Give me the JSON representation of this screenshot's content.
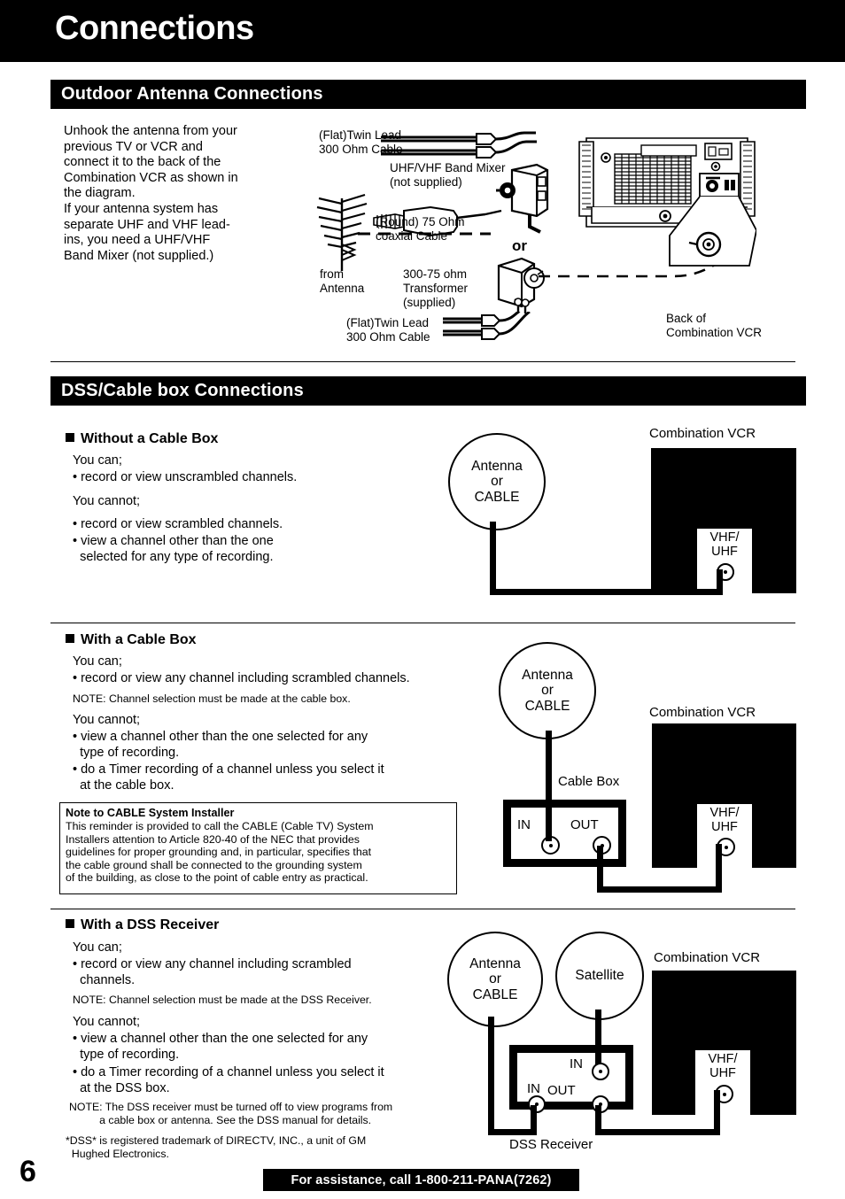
{
  "document": {
    "title": "Connections",
    "page_number": "6"
  },
  "sections": {
    "outdoor": {
      "header": "Outdoor Antenna Connections",
      "body": "Unhook the antenna from your\nprevious TV or VCR and\nconnect it to the back of the\nCombination VCR as shown in\nthe diagram.\nIf your antenna system has\nseparate UHF and VHF lead-\nins, you need a UHF/VHF\nBand Mixer (not supplied.)",
      "diagram": {
        "twin_lead_top": "(Flat)Twin Lead\n300 Ohm Cable",
        "band_mixer": "UHF/VHF Band Mixer\n(not supplied)",
        "coaxial": "(Round) 75 Ohm\ncoaxial Cable",
        "or": "or",
        "from_antenna": "from\nAntenna",
        "transformer": "300-75 ohm\nTransformer\n(supplied)",
        "twin_lead_bottom": "(Flat)Twin Lead\n300 Ohm Cable",
        "back_of_vcr": "Back of\nCombination VCR"
      }
    },
    "dss": {
      "header": "DSS/Cable box Connections",
      "without_cable_box": {
        "heading": "Without a Cable Box",
        "can_label": "You can;",
        "can_items": [
          "• record or view unscrambled channels."
        ],
        "cannot_label": "You cannot;",
        "cannot_items": [
          "• record or view scrambled channels.",
          "• view a channel other than the one\n  selected for any type of recording."
        ],
        "diagram": {
          "source_circle": "Antenna\nor\nCABLE",
          "vcr_label": "Combination VCR",
          "vcr_jack": "VHF/\nUHF"
        }
      },
      "with_cable_box": {
        "heading": "With a Cable Box",
        "can_label": "You can;",
        "can_items": [
          "• record or view any channel including scrambled channels."
        ],
        "note": "NOTE: Channel selection must be made at the cable box.",
        "cannot_label": "You cannot;",
        "cannot_items": [
          "• view a channel other than the one selected for any\n  type of recording.",
          "• do a Timer recording of a channel unless you select it\n  at the cable box."
        ],
        "installer_note": {
          "title": "Note to CABLE System Installer",
          "body": "This reminder is provided to call the CABLE (Cable TV) System\nInstallers attention to Article 820-40 of the NEC that provides\nguidelines for proper grounding and, in particular, specifies that\nthe cable ground shall be connected to the grounding system\nof the building, as close to the point of cable entry as practical."
        },
        "diagram": {
          "source_circle": "Antenna\nor\nCABLE",
          "cable_box_label": "Cable Box",
          "cable_box_in": "IN",
          "cable_box_out": "OUT",
          "vcr_label": "Combination VCR",
          "vcr_jack": "VHF/\nUHF"
        }
      },
      "with_dss_receiver": {
        "heading": "With a DSS Receiver",
        "can_label": "You can;",
        "can_items": [
          "• record or view any channel including scrambled\n  channels."
        ],
        "note": "NOTE: Channel selection must be made at the DSS Receiver.",
        "cannot_label": "You cannot;",
        "cannot_items": [
          "• view a channel other than the one selected for any\n  type of recording.",
          "• do a Timer recording of a channel unless you select it\n  at the DSS box."
        ],
        "note2": "NOTE: The DSS receiver must be turned off to view programs from\n          a cable box or antenna. See the DSS manual for details.",
        "trademark": "*DSS* is registered trademark of DIRECTV, INC., a unit of GM\n  Hughed Electronics.",
        "diagram": {
          "source_circle": "Antenna\nor\nCABLE",
          "satellite_circle": "Satellite",
          "receiver_label": "DSS Receiver",
          "receiver_in_left": "IN",
          "receiver_in_top": "IN",
          "receiver_out": "OUT",
          "vcr_label": "Combination VCR",
          "vcr_jack": "VHF/\nUHF"
        }
      }
    }
  },
  "footer": {
    "assistance": "For assistance, call 1-800-211-PANA(7262)"
  }
}
